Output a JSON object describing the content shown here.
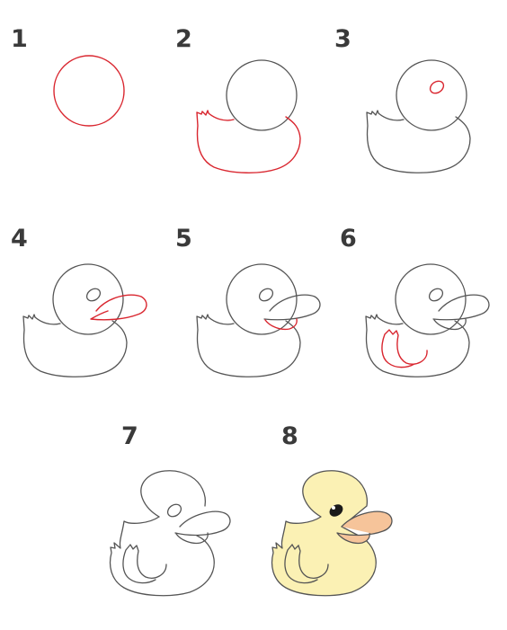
{
  "steps": [
    {
      "number": "1"
    },
    {
      "number": "2"
    },
    {
      "number": "3"
    },
    {
      "number": "4"
    },
    {
      "number": "5"
    },
    {
      "number": "6"
    },
    {
      "number": "7"
    },
    {
      "number": "8"
    }
  ],
  "colors": {
    "outline": "#555555",
    "new_stroke": "#d9262f",
    "body_fill": "#fbf1b4",
    "beak_fill": "#f6c49a",
    "eye": "#1a1a1a"
  }
}
